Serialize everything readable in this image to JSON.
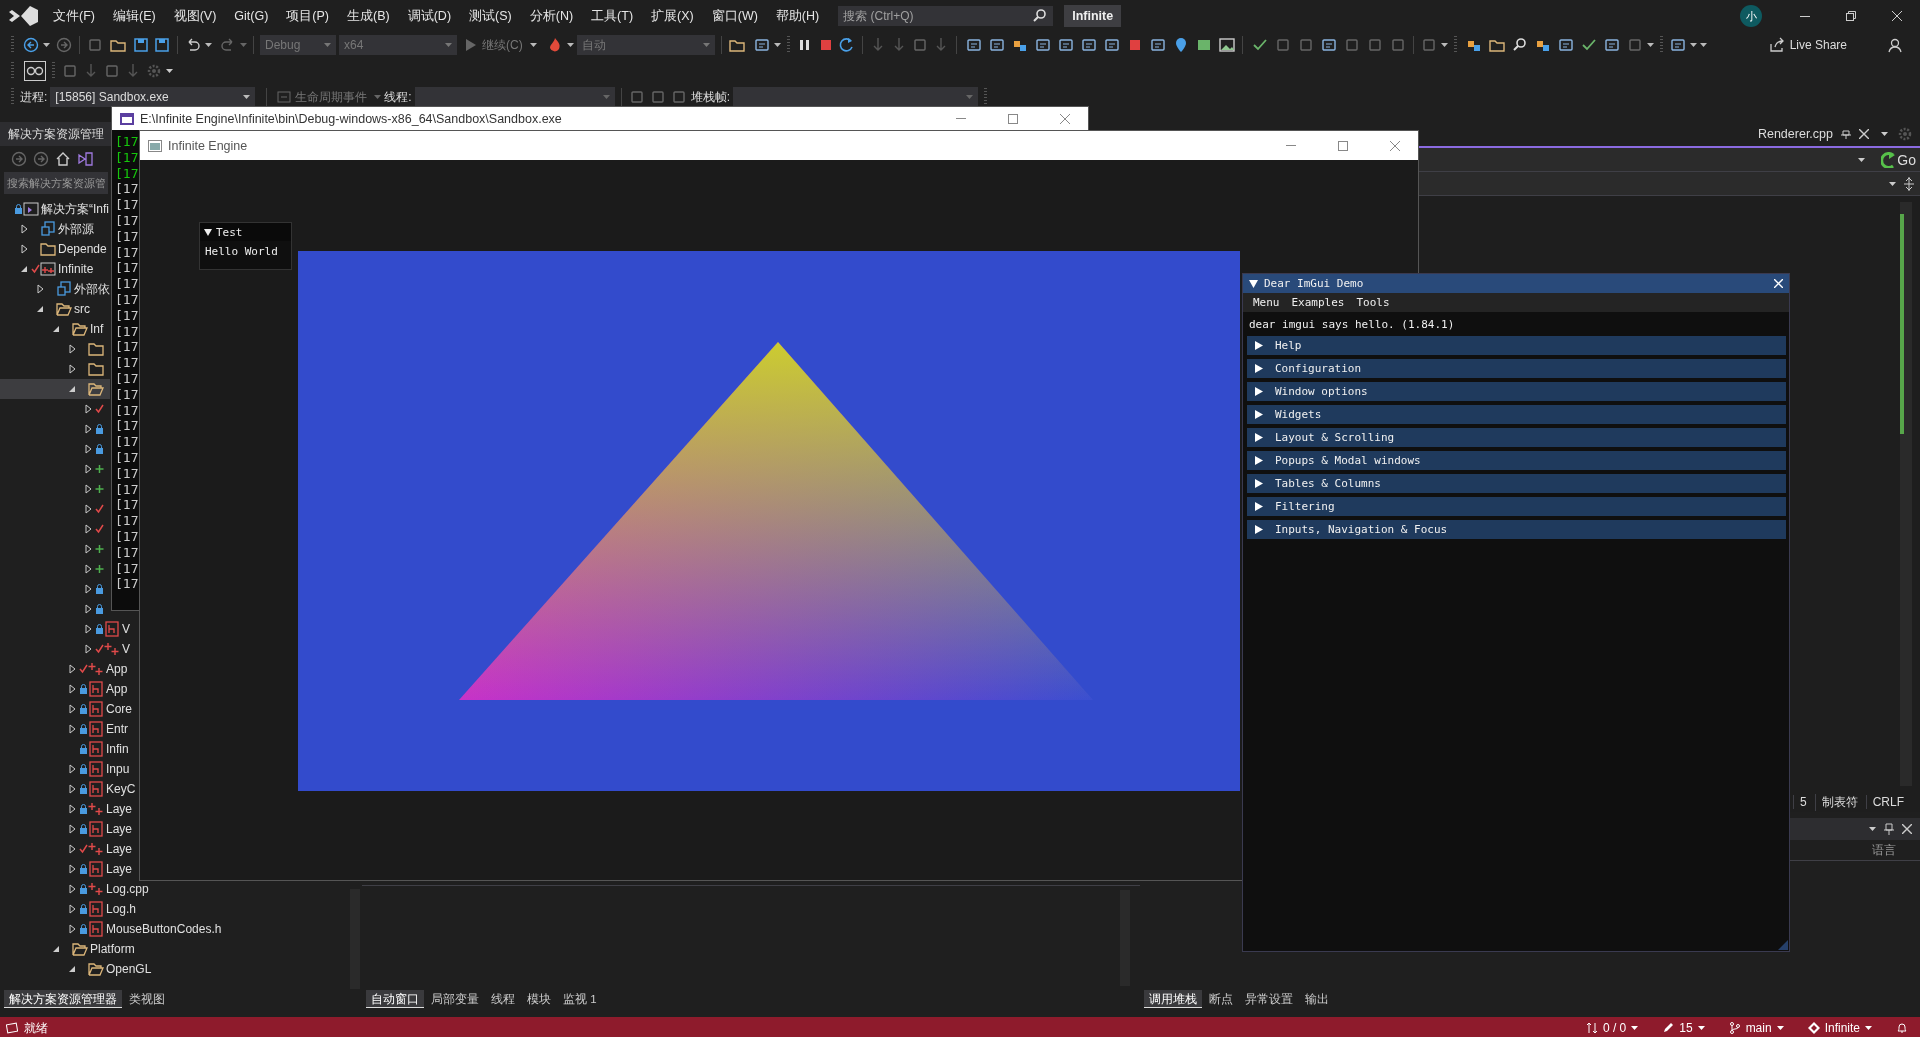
{
  "menu_bar": {
    "menus": [
      "文件(F)",
      "编辑(E)",
      "视图(V)",
      "Git(G)",
      "项目(P)",
      "生成(B)",
      "调试(D)",
      "测试(S)",
      "分析(N)",
      "工具(T)",
      "扩展(X)",
      "窗口(W)",
      "帮助(H)"
    ],
    "search": {
      "placeholder": "搜索 (Ctrl+Q)"
    },
    "solution_badge": "Infinite",
    "avatar": "小"
  },
  "toolbar": {
    "configuration": {
      "value": "Debug",
      "disabled": true
    },
    "platform": {
      "value": "x64",
      "disabled": true
    },
    "continue_button": {
      "label": "继续(C)",
      "disabled": true
    },
    "target": {
      "value": "自动",
      "disabled": true
    },
    "live_share": "Live Share"
  },
  "debug_location": {
    "process_label": "进程:",
    "process": "[15856] Sandbox.exe",
    "lifecycle": "生命周期事件",
    "thread_label": "线程:",
    "stack_label": "堆栈帧:"
  },
  "solution_explorer": {
    "title": "解决方案资源管理",
    "search": {
      "placeholder": "搜索解决方案资源管"
    },
    "tree": [
      {
        "label": "解决方案“Infi",
        "kind": "solution",
        "locked": true,
        "checked_out": false,
        "added": false,
        "selected": false,
        "children": [
          {
            "label": "外部源",
            "kind": "reference",
            "expanded": false,
            "selected": false
          },
          {
            "label": "Depende",
            "kind": "folder",
            "expanded": false,
            "selected": false
          },
          {
            "label": "Infinite",
            "kind": "project",
            "locked": false,
            "checked_out": true,
            "added": false,
            "expanded": true,
            "selected": false,
            "children": [
              {
                "label": "外部依",
                "kind": "reference",
                "expanded": false,
                "selected": false
              },
              {
                "label": "src",
                "kind": "openfolder",
                "expanded": true,
                "selected": false,
                "children": [
                  {
                    "label": "Inf",
                    "kind": "openfolder",
                    "expanded": true,
                    "selected": false,
                    "children": [
                      {
                        "kind": "folder",
                        "expanded": false,
                        "selected": false
                      },
                      {
                        "kind": "folder",
                        "expanded": false,
                        "selected": false
                      },
                      {
                        "kind": "openfolder",
                        "expanded": true,
                        "selected": true,
                        "children": [
                          {
                            "locked": false,
                            "checked_out": true,
                            "added": false,
                            "expanded": false,
                            "selected": false
                          },
                          {
                            "locked": true,
                            "checked_out": false,
                            "added": false,
                            "expanded": false,
                            "selected": false
                          },
                          {
                            "locked": true,
                            "checked_out": false,
                            "added": false,
                            "expanded": false,
                            "selected": false
                          },
                          {
                            "locked": false,
                            "checked_out": false,
                            "added": true,
                            "expanded": false,
                            "selected": false
                          },
                          {
                            "locked": false,
                            "checked_out": false,
                            "added": true,
                            "expanded": false,
                            "selected": false
                          },
                          {
                            "locked": false,
                            "checked_out": true,
                            "added": false,
                            "expanded": false,
                            "selected": false
                          },
                          {
                            "locked": false,
                            "checked_out": true,
                            "added": false,
                            "expanded": false,
                            "selected": false
                          },
                          {
                            "locked": false,
                            "checked_out": false,
                            "added": true,
                            "expanded": false,
                            "selected": false
                          },
                          {
                            "locked": false,
                            "checked_out": false,
                            "added": true,
                            "expanded": false,
                            "selected": false
                          },
                          {
                            "locked": true,
                            "checked_out": false,
                            "added": false,
                            "expanded": false,
                            "selected": false
                          },
                          {
                            "locked": true,
                            "checked_out": false,
                            "added": false,
                            "expanded": false,
                            "selected": false
                          },
                          {
                            "label": "V",
                            "kind": "header",
                            "locked": true,
                            "checked_out": false,
                            "added": false,
                            "expanded": false,
                            "selected": false
                          },
                          {
                            "label": "V",
                            "kind": "source",
                            "locked": false,
                            "checked_out": true,
                            "added": false,
                            "expanded": false,
                            "selected": false
                          }
                        ]
                      },
                      {
                        "label": "App",
                        "kind": "source",
                        "locked": false,
                        "checked_out": true,
                        "added": false,
                        "expanded": false,
                        "selected": false
                      },
                      {
                        "label": "App",
                        "kind": "header",
                        "locked": true,
                        "checked_out": false,
                        "added": false,
                        "expanded": false,
                        "selected": false
                      },
                      {
                        "label": "Core",
                        "kind": "header",
                        "locked": true,
                        "checked_out": false,
                        "added": false,
                        "expanded": false,
                        "selected": false
                      },
                      {
                        "label": "Entr",
                        "kind": "header",
                        "locked": true,
                        "checked_out": false,
                        "added": false,
                        "expanded": false,
                        "selected": false
                      },
                      {
                        "label": "Infin",
                        "kind": "header",
                        "locked": true,
                        "checked_out": false,
                        "added": false,
                        "selected": false
                      },
                      {
                        "label": "Inpu",
                        "kind": "header",
                        "locked": true,
                        "checked_out": false,
                        "added": false,
                        "expanded": false,
                        "selected": false
                      },
                      {
                        "label": "KeyC",
                        "kind": "header",
                        "locked": true,
                        "checked_out": false,
                        "added": false,
                        "expanded": false,
                        "selected": false
                      },
                      {
                        "label": "Laye",
                        "kind": "source",
                        "locked": true,
                        "checked_out": false,
                        "added": false,
                        "expanded": false,
                        "selected": false
                      },
                      {
                        "label": "Laye",
                        "kind": "header",
                        "locked": true,
                        "checked_out": false,
                        "added": false,
                        "expanded": false,
                        "selected": false
                      },
                      {
                        "label": "Laye",
                        "kind": "source",
                        "locked": false,
                        "checked_out": true,
                        "added": false,
                        "expanded": false,
                        "selected": false
                      },
                      {
                        "label": "Laye",
                        "kind": "header",
                        "locked": true,
                        "checked_out": false,
                        "added": false,
                        "expanded": false,
                        "selected": false
                      },
                      {
                        "label": "Log.cpp",
                        "kind": "source",
                        "locked": true,
                        "checked_out": false,
                        "added": false,
                        "expanded": false,
                        "selected": false
                      },
                      {
                        "label": "Log.h",
                        "kind": "header",
                        "locked": true,
                        "checked_out": false,
                        "added": false,
                        "expanded": false,
                        "selected": false
                      },
                      {
                        "label": "MouseButtonCodes.h",
                        "kind": "header",
                        "locked": true,
                        "checked_out": false,
                        "added": false,
                        "expanded": false,
                        "selected": false
                      }
                    ]
                  },
                  {
                    "label": "Platform",
                    "kind": "openfolder",
                    "expanded": true,
                    "selected": false,
                    "children": [
                      {
                        "label": "OpenGL",
                        "kind": "openfolder",
                        "expanded": true,
                        "selected": false
                      }
                    ]
                  }
                ]
              }
            ]
          }
        ]
      }
    ],
    "tabs": [
      {
        "label": "解决方案资源管理器",
        "selected": true
      },
      {
        "label": "类视图",
        "selected": false
      }
    ]
  },
  "console_window": {
    "title": "E:\\Infinite Engine\\Infinite\\bin\\Debug-windows-x86_64\\Sandbox\\Sandbox.exe",
    "lines": [
      {
        "text": "[17",
        "kind": "info"
      },
      {
        "text": "[17",
        "kind": "info"
      },
      {
        "text": "[17",
        "kind": "info"
      },
      {
        "text": "[17",
        "kind": "trace"
      },
      {
        "text": "[17",
        "kind": "trace"
      },
      {
        "text": "[17",
        "kind": "trace"
      },
      {
        "text": "[17",
        "kind": "trace"
      },
      {
        "text": "[17",
        "kind": "trace"
      },
      {
        "text": "[17",
        "kind": "trace"
      },
      {
        "text": "[17",
        "kind": "trace"
      },
      {
        "text": "[17",
        "kind": "trace"
      },
      {
        "text": "[17",
        "kind": "trace"
      },
      {
        "text": "[17",
        "kind": "trace"
      },
      {
        "text": "[17",
        "kind": "trace"
      },
      {
        "text": "[17",
        "kind": "trace"
      },
      {
        "text": "[17",
        "kind": "trace"
      },
      {
        "text": "[17",
        "kind": "trace"
      },
      {
        "text": "[17",
        "kind": "trace"
      },
      {
        "text": "[17",
        "kind": "trace"
      },
      {
        "text": "[17",
        "kind": "trace"
      },
      {
        "text": "[17",
        "kind": "trace"
      },
      {
        "text": "[17",
        "kind": "trace"
      },
      {
        "text": "[17",
        "kind": "trace"
      },
      {
        "text": "[17",
        "kind": "trace"
      },
      {
        "text": "[17",
        "kind": "trace"
      },
      {
        "text": "[17",
        "kind": "trace"
      },
      {
        "text": "[17",
        "kind": "trace"
      },
      {
        "text": "[17",
        "kind": "trace"
      },
      {
        "text": "[17",
        "kind": "trace"
      }
    ]
  },
  "engine_window": {
    "title": "Infinite Engine",
    "test_window": {
      "title": "Test",
      "expanded": true,
      "text": "Hello World"
    }
  },
  "imgui_demo": {
    "title": "Dear ImGui Demo",
    "expanded": true,
    "menus": [
      "Menu",
      "Examples",
      "Tools"
    ],
    "text": "dear imgui says hello. (1.84.1)",
    "headers": [
      {
        "label": "Help",
        "expanded": false
      },
      {
        "label": "Configuration",
        "expanded": false
      },
      {
        "label": "Window options",
        "expanded": false
      },
      {
        "label": "Widgets",
        "expanded": false
      },
      {
        "label": "Layout & Scrolling",
        "expanded": false
      },
      {
        "label": "Popups & Modal windows",
        "expanded": false
      },
      {
        "label": "Tables & Columns",
        "expanded": false
      },
      {
        "label": "Filtering",
        "expanded": false
      },
      {
        "label": "Inputs, Navigation & Focus",
        "expanded": false
      }
    ]
  },
  "editor": {
    "tab": "Renderer.cpp",
    "go_button": "Go",
    "status": [
      "5",
      "制表符",
      "CRLF"
    ]
  },
  "debug_panels": {
    "locals_tabs": [
      {
        "label": "自动窗口",
        "selected": true
      },
      {
        "label": "局部变量",
        "selected": false
      },
      {
        "label": "线程",
        "selected": false
      },
      {
        "label": "模块",
        "selected": false
      },
      {
        "label": "监视 1",
        "selected": false
      }
    ],
    "call_stack": {
      "column": "语言",
      "tabs": [
        {
          "label": "调用堆栈",
          "selected": true
        },
        {
          "label": "断点",
          "selected": false
        },
        {
          "label": "异常设置",
          "selected": false
        },
        {
          "label": "输出",
          "selected": false
        }
      ]
    }
  },
  "status_bar": {
    "message": "就绪",
    "changes": "0 / 0",
    "edits": "15",
    "branch": "main",
    "repository": "Infinite"
  }
}
